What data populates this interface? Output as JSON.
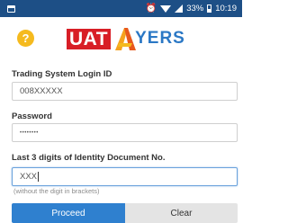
{
  "status_bar": {
    "battery_percent": "33%",
    "time": "10:19",
    "icons": [
      "notification-app-icon",
      "alarm-icon",
      "wifi-icon",
      "signal-icon",
      "battery-icon"
    ]
  },
  "header": {
    "help_glyph": "?",
    "logo": {
      "uat_text": "UAT",
      "brand_text": "YERS"
    }
  },
  "form": {
    "login_id": {
      "label": "Trading System Login ID",
      "value": "008XXXXX"
    },
    "password": {
      "label": "Password",
      "value": "••••••••"
    },
    "id_digits": {
      "label": "Last 3 digits of Identity Document No.",
      "value": "XXX",
      "hint": "(without the digit in brackets)"
    }
  },
  "buttons": {
    "proceed": "Proceed",
    "clear": "Clear"
  },
  "colors": {
    "status_bar": "#1d4f86",
    "help_icon": "#f5ba1e",
    "uat_red": "#d81e26",
    "brand_blue": "#2b78c5",
    "proceed": "#2f80cf",
    "clear": "#e4e4e4"
  }
}
